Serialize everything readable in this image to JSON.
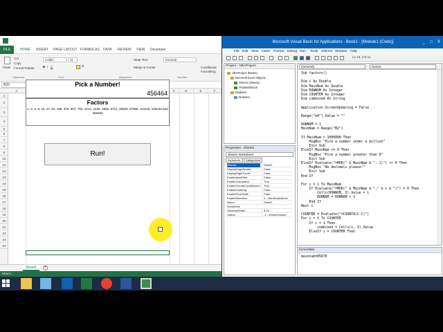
{
  "excel": {
    "file_tab": "FILE",
    "tabs": [
      "HOME",
      "INSERT",
      "PAGE LAYOUT",
      "FORMULAS",
      "DATA",
      "REVIEW",
      "VIEW",
      "Developer"
    ],
    "clipboard": {
      "paste": "Paste",
      "cut": "Cut",
      "copy": "Copy",
      "format_painter": "Format Painter",
      "group": "Clipboard"
    },
    "font": {
      "name": "Calibri",
      "size": "11",
      "group": "Font"
    },
    "alignment": {
      "wrap": "Wrap Text",
      "merge": "Merge & Center",
      "group": "Alignment"
    },
    "number": {
      "format": "General",
      "group": "Number"
    },
    "styles": {
      "conditional": "Conditional",
      "formatting": "Formatting"
    },
    "name_box": "B20",
    "fx": "fx",
    "columns": [
      "A",
      "B",
      "C",
      "D",
      "E",
      "F"
    ],
    "rows": [
      "1",
      "2",
      "3",
      "4",
      "5",
      "6",
      "7",
      "8",
      "9",
      "10",
      "11",
      "12",
      "13",
      "14",
      "15",
      "16",
      "17",
      "18",
      "19",
      "20",
      "21",
      "22",
      "23",
      "24"
    ],
    "cells": {
      "pick_title": "Pick a Number!",
      "main_number": "456464",
      "factors_title": "Factors",
      "factors_values": "1, 2, 4, 8, 16, 47, 94, 188, 376, 607, 752, 1214, 2428, 4856, 9712, 28529, 57058, 114116, 228232 and 456464"
    },
    "run_button": "Run!",
    "sheet_tab": "Sheet1",
    "add_sheet": "+",
    "status": "READY"
  },
  "vbe": {
    "title": "Microsoft Visual Basic for Applications - Book1 - [Module1 (Code)]",
    "window_buttons": [
      "_",
      "□",
      "X"
    ],
    "menu": [
      "File",
      "Edit",
      "View",
      "Insert",
      "Format",
      "Debug",
      "Run",
      "Tools",
      "Add-Ins",
      "Window",
      "Help"
    ],
    "line_col": "Ln 15, Col 11",
    "project": {
      "header": "Project - VBAProject",
      "items": [
        "VBAProject (Book1)",
        "Microsoft Excel Objects",
        "Sheet1 (Sheet1)",
        "ThisWorkbook",
        "Modules",
        "Module1"
      ]
    },
    "properties": {
      "header": "Properties - Sheet1",
      "object": "Sheet1 Worksheet",
      "tabs": [
        "Alphabetic",
        "Categorized"
      ],
      "rows": [
        [
          "(Name)",
          "Sheet1"
        ],
        [
          "DisplayPageBreaks",
          "False"
        ],
        [
          "DisplayRightToLeft",
          "False"
        ],
        [
          "EnableAutoFilter",
          "False"
        ],
        [
          "EnableCalculation",
          "True"
        ],
        [
          "EnableFormatConditionsCal",
          "True"
        ],
        [
          "EnableOutlining",
          "False"
        ],
        [
          "EnablePivotTable",
          "False"
        ],
        [
          "EnableSelection",
          "0 - xlNoRestrictions"
        ],
        [
          "Name",
          "Sheet1"
        ],
        [
          "ScrollArea",
          ""
        ],
        [
          "StandardWidth",
          "8.43"
        ],
        [
          "Visible",
          "-1 - xlSheetVisible"
        ]
      ]
    },
    "code_window": {
      "object_dd": "(General)",
      "proc_dd": "factors",
      "lines": [
        "Sub factors()",
        "",
        "Dim i As Double",
        "Dim MainNum As Double",
        "Dim ROWNUM As Integer",
        "Dim COUNTER As Integer",
        "Dim combined As String",
        "",
        "Application.ScreenUpdating = False",
        "",
        "Range(\"b4\").Value = \"\"",
        "",
        "ROWNUM = 1",
        "MainNum = Range(\"B2\")",
        "",
        "If MainNum > 1000000 Then",
        "    MsgBox \"Pick a number under a million\"",
        "    Exit Sub",
        "ElseIf MainNum <= 0 Then",
        "    MsgBox \"Pick a number greater than 0\"",
        "    Exit Sub",
        "ElseIf Evaluate(\"=MOD(\" & MainNum & \", 1)\") <> 0 Then",
        "    MsgBox \"No decimals please!\"",
        "    Exit Sub",
        "End If",
        "",
        "For i = 1 To MainNum",
        "    If Evaluate(\"=MOD(\" & MainNum & \",\" & i & \")\") = 0 Then",
        "        Cells(ROWNUM, 3).Value = i",
        "        ROWNUM = ROWNUM + 1",
        "    End If",
        "Next i",
        "",
        "COUNTER = Evaluate(\"=COUNTA(C:C)\")",
        "For i = 1 To COUNTER",
        "    If i = 1 Then",
        "        combined = Cells(i, 3).Value",
        "    ElseIf i = COUNTER Then"
      ]
    },
    "immediate": {
      "header": "Immediate",
      "text": "mainnum=85670"
    }
  },
  "colors": {
    "excel_green": "#217346",
    "vbe_blue": "#0b63b8",
    "taskbar": "#1f2a44",
    "highlight": "#ffea00"
  }
}
